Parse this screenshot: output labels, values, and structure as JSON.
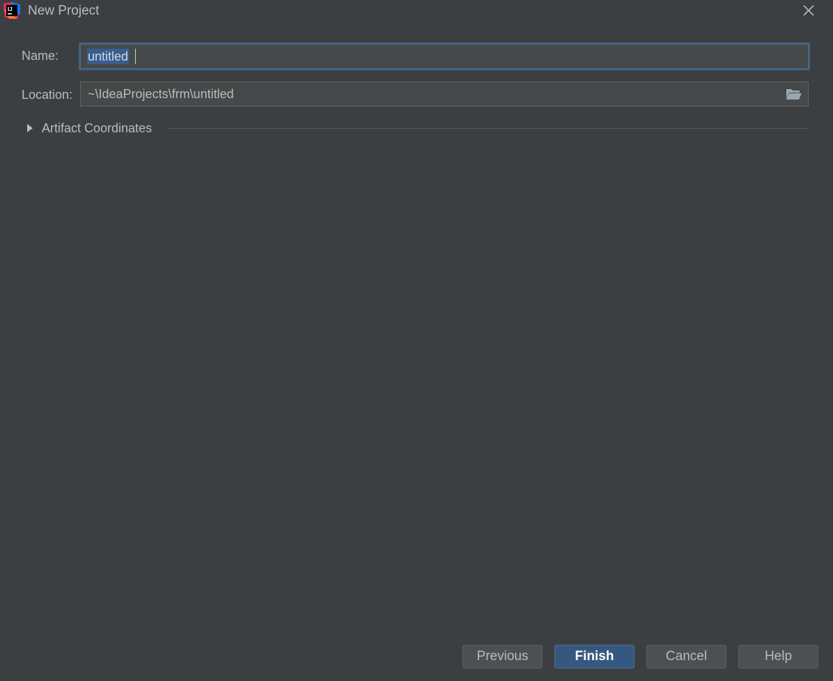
{
  "window": {
    "title": "New Project",
    "app_icon": "intellij-idea-icon",
    "close_icon": "close-icon"
  },
  "form": {
    "name_label": "Name:",
    "name_value": "untitled",
    "location_label": "Location:",
    "location_value": "~\\IdeaProjects\\frm\\untitled",
    "browse_icon": "folder-icon",
    "artifact_section_label": "Artifact Coordinates",
    "artifact_expanded": false
  },
  "buttons": {
    "previous": "Previous",
    "finish": "Finish",
    "cancel": "Cancel",
    "help": "Help"
  },
  "colors": {
    "background": "#3c3f41",
    "field_background": "#45494a",
    "focus_border": "#3d6185",
    "primary_button": "#365880",
    "text": "#bbbbbb"
  }
}
